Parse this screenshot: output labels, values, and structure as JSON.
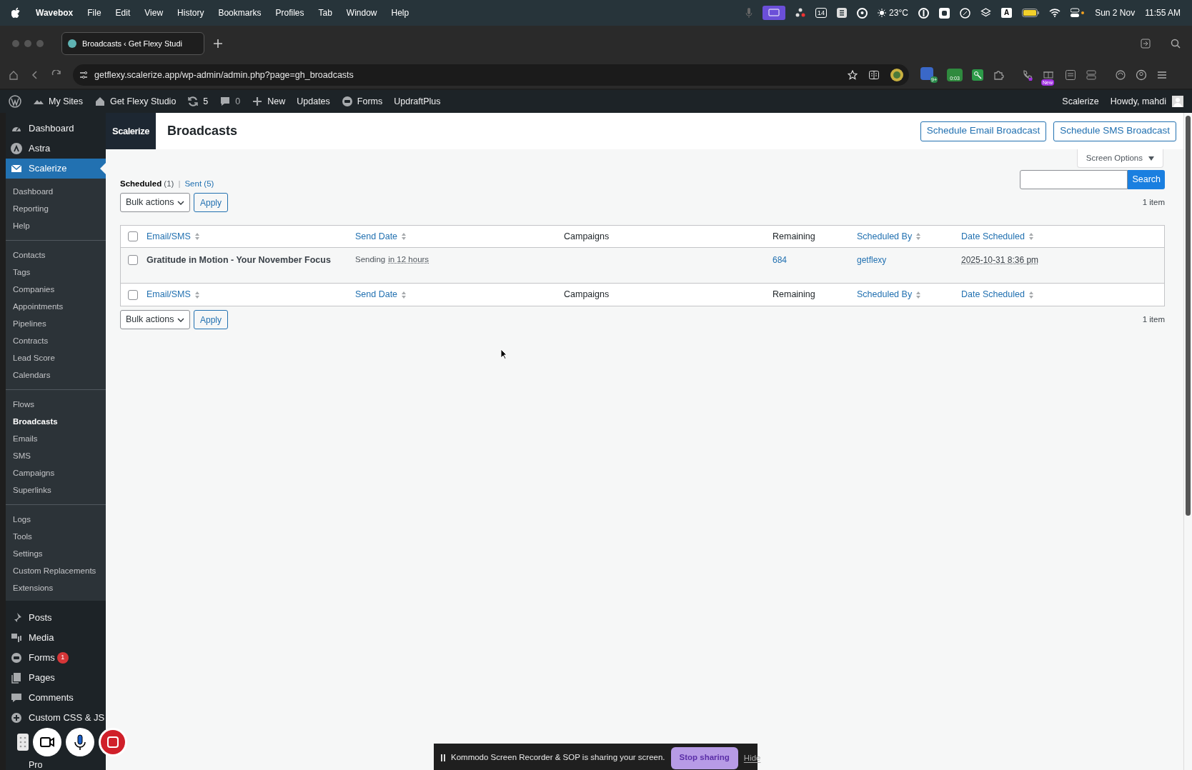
{
  "menu_bar": {
    "app": "Wavebox",
    "items": [
      "File",
      "Edit",
      "View",
      "History",
      "Bookmarks",
      "Profiles",
      "Tab",
      "Window",
      "Help"
    ],
    "calendar_badge": "14",
    "weather": "23°C",
    "input_source": "A",
    "date": "Sun 2 Nov",
    "time": "11:55 AM"
  },
  "browser": {
    "tab_title": "Broadcasts ‹ Get Flexy Studi",
    "url": "getflexy.scalerize.app/wp-admin/admin.php?page=gh_broadcasts",
    "badges": [
      "9+",
      "0:03",
      "New"
    ]
  },
  "admin_bar": {
    "items": [
      {
        "kind": "sites",
        "label": "My Sites"
      },
      {
        "kind": "home",
        "label": "Get Flexy Studio"
      },
      {
        "kind": "updates",
        "label": "5"
      },
      {
        "kind": "comments",
        "label": "0"
      },
      {
        "kind": "new",
        "label": "New"
      },
      {
        "kind": "plain",
        "label": "Updates"
      },
      {
        "kind": "forms",
        "label": "Forms"
      },
      {
        "kind": "plain",
        "label": "UpdraftPlus"
      }
    ],
    "right": [
      "Scalerize",
      "Howdy, mahdi"
    ]
  },
  "sidebar": {
    "top": [
      {
        "kind": "dashboard",
        "label": "Dashboard",
        "selected": false
      },
      {
        "kind": "astra",
        "label": "Astra",
        "selected": false
      },
      {
        "kind": "mail",
        "label": "Scalerize",
        "selected": true
      }
    ],
    "submenu": [
      [
        {
          "label": "Dashboard",
          "selected": false
        },
        {
          "label": "Reporting",
          "selected": false
        },
        {
          "label": "Help",
          "selected": false
        }
      ],
      [
        {
          "label": "Contacts",
          "selected": false
        },
        {
          "label": "Tags",
          "selected": false
        },
        {
          "label": "Companies",
          "selected": false
        },
        {
          "label": "Appointments",
          "selected": false
        },
        {
          "label": "Pipelines",
          "selected": false
        },
        {
          "label": "Contracts",
          "selected": false
        },
        {
          "label": "Lead Score",
          "selected": false
        },
        {
          "label": "Calendars",
          "selected": false
        }
      ],
      [
        {
          "label": "Flows",
          "selected": false
        },
        {
          "label": "Broadcasts",
          "selected": true
        },
        {
          "label": "Emails",
          "selected": false
        },
        {
          "label": "SMS",
          "selected": false
        },
        {
          "label": "Campaigns",
          "selected": false
        },
        {
          "label": "Superlinks",
          "selected": false
        }
      ],
      [
        {
          "label": "Logs",
          "selected": false
        },
        {
          "label": "Tools",
          "selected": false
        },
        {
          "label": "Settings",
          "selected": false
        },
        {
          "label": "Custom Replacements",
          "selected": false
        },
        {
          "label": "Extensions",
          "selected": false
        }
      ]
    ],
    "bottom": [
      {
        "kind": "pin",
        "label": "Posts"
      },
      {
        "kind": "media",
        "label": "Media"
      },
      {
        "kind": "forms",
        "label": "Forms",
        "badge": "1"
      },
      {
        "kind": "pages",
        "label": "Pages"
      },
      {
        "kind": "comments",
        "label": "Comments"
      },
      {
        "kind": "plus",
        "label": "Custom CSS & JS"
      },
      {
        "kind": "covered",
        "label": "Pro"
      }
    ]
  },
  "header": {
    "logo": "Scalerize",
    "title": "Broadcasts",
    "buttons": [
      "Schedule Email Broadcast",
      "Schedule SMS Broadcast"
    ]
  },
  "screen_options": "Screen Options",
  "view_separator": "|",
  "header_checkbox": {
    "checked": false
  },
  "footer_checkbox": {
    "checked": false
  },
  "views": [
    {
      "label": "Scheduled",
      "count": "(1)",
      "selected": true
    },
    {
      "label": "Sent",
      "count": "(5)",
      "selected": false
    }
  ],
  "search_button": "Search",
  "bulk_top": {
    "select": "Bulk actions",
    "apply": "Apply",
    "count": "1 item"
  },
  "columns": [
    {
      "label": "Email/SMS",
      "sortable": true
    },
    {
      "label": "Send Date",
      "sortable": true
    },
    {
      "label": "Campaigns",
      "sortable": false
    },
    {
      "label": "Remaining",
      "sortable": false
    },
    {
      "label": "Scheduled By",
      "sortable": true
    },
    {
      "label": "Date Scheduled",
      "sortable": true
    }
  ],
  "rows": [
    {
      "checked": false,
      "title": "Gratitude in Motion - Your November Focus",
      "send_status": "Sending",
      "send_time": "in 12 hours",
      "remaining": "684",
      "scheduled_by": "getflexy",
      "date_scheduled": "2025-10-31 8:36 pm"
    }
  ],
  "footer_columns": [
    {
      "label": "Email/SMS",
      "sortable": true
    },
    {
      "label": "Send Date",
      "sortable": true
    },
    {
      "label": "Campaigns",
      "sortable": false
    },
    {
      "label": "Remaining",
      "sortable": false
    },
    {
      "label": "Scheduled By",
      "sortable": true
    },
    {
      "label": "Date Scheduled",
      "sortable": true
    }
  ],
  "bulk_bottom": {
    "select": "Bulk actions",
    "apply": "Apply",
    "count": "1 item"
  },
  "sharing_bar": {
    "message": "Kommodo Screen Recorder & SOP is sharing your screen.",
    "stop": "Stop sharing",
    "hide": "Hide"
  }
}
